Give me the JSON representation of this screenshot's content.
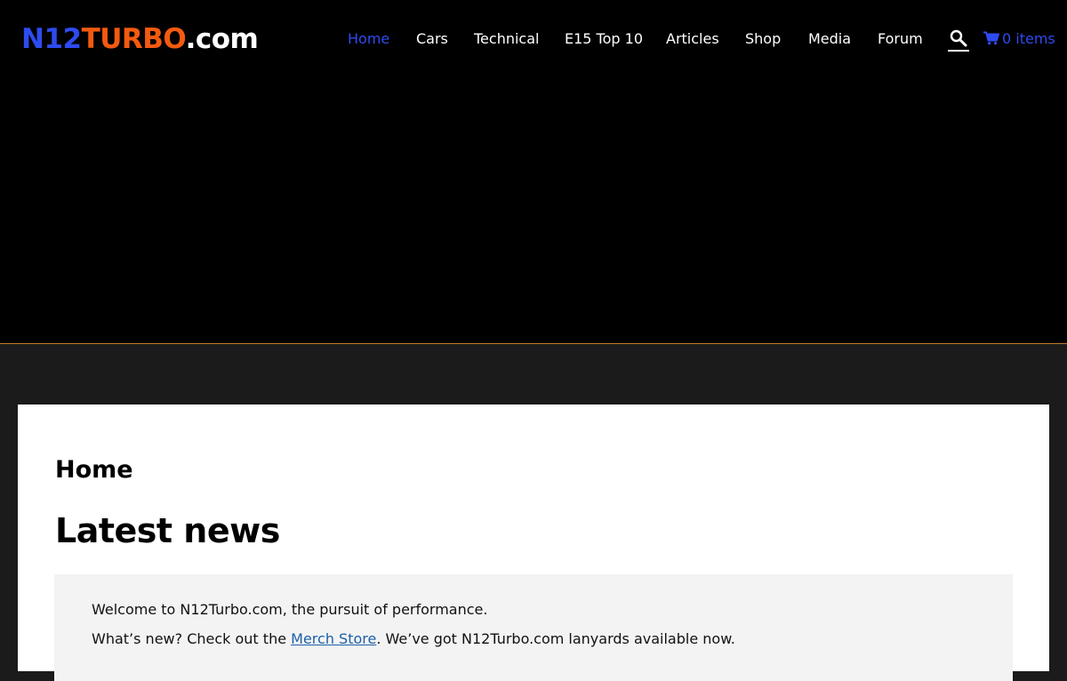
{
  "colors": {
    "accent": "#2e4bf0",
    "logo_blue": "#2e4bf0",
    "logo_orange": "#f35a0f",
    "header_rule": "#c07a2a",
    "page_bg": "#1b1b1b"
  },
  "header": {
    "logo": {
      "part1": "N12",
      "part2": "TURBO",
      "part3": ".com"
    },
    "nav": [
      {
        "label": "Home",
        "active": true
      },
      {
        "label": "Cars"
      },
      {
        "label": "Technical"
      },
      {
        "label": "E15 Top 10"
      },
      {
        "label": "Articles"
      },
      {
        "label": "Shop"
      },
      {
        "label": "Media"
      },
      {
        "label": "Forum"
      }
    ],
    "search_icon": "search-icon",
    "cart": {
      "icon": "cart-icon",
      "label": "0 items"
    }
  },
  "main": {
    "page_title": "Home",
    "section_heading": "Latest news",
    "news": {
      "line1": "Welcome to N12Turbo.com, the pursuit of performance.",
      "line2_before": "What’s new? Check out the ",
      "line2_link": "Merch Store",
      "line2_after": ". We’ve got N12Turbo.com lanyards available now."
    }
  }
}
